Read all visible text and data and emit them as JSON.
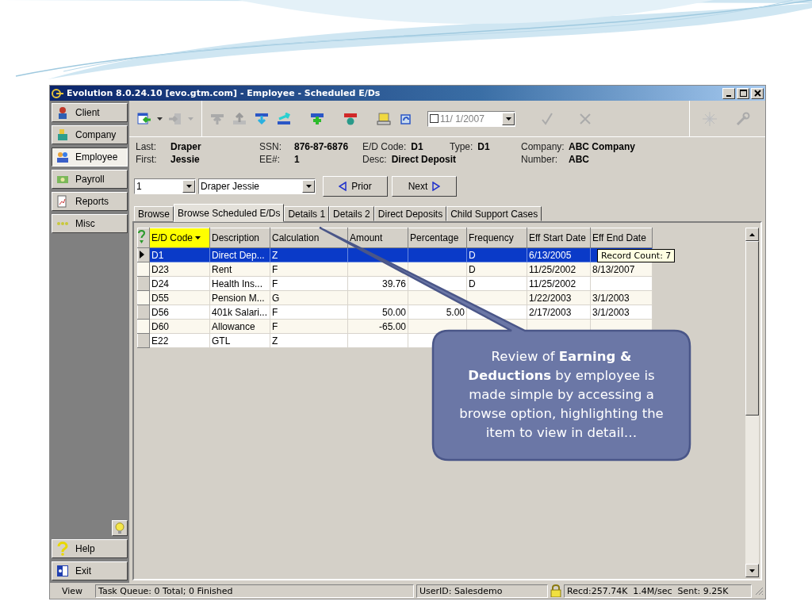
{
  "window": {
    "title": "Evolution 8.0.24.10 [evo.gtm.com] - Employee - Scheduled E/Ds"
  },
  "sidebar": {
    "items": [
      {
        "label": "Client",
        "selected": false
      },
      {
        "label": "Company",
        "selected": false
      },
      {
        "label": "Employee",
        "selected": true
      },
      {
        "label": "Payroll",
        "selected": false
      },
      {
        "label": "Reports",
        "selected": false
      },
      {
        "label": "Misc",
        "selected": false
      }
    ],
    "bottom_items": [
      {
        "label": "Help"
      },
      {
        "label": "Exit"
      }
    ]
  },
  "toolbar": {
    "date": "11/ 1/2007",
    "date_checked": false
  },
  "employee": {
    "groups": [
      {
        "lines": [
          {
            "label": "Last:",
            "value": "Draper"
          },
          {
            "label": "First:",
            "value": "Jessie"
          }
        ]
      },
      {
        "lines": [
          {
            "label": "SSN:",
            "value": "876-87-6876"
          },
          {
            "label": "EE#:",
            "value": "1"
          }
        ]
      },
      {
        "lines": [
          {
            "label": "E/D Code:",
            "value": "D1"
          },
          {
            "label": "Desc:",
            "value": "Direct Deposit"
          }
        ]
      },
      {
        "lines": [
          {
            "label": "Type:",
            "value": "D1"
          }
        ]
      },
      {
        "lines": [
          {
            "label": "Company:",
            "value": "ABC Company"
          },
          {
            "label": "Number:",
            "value": "ABC"
          }
        ]
      }
    ]
  },
  "selector": {
    "number": "1",
    "name": "Draper Jessie",
    "prior": "Prior",
    "next": "Next"
  },
  "tabs": [
    {
      "label": "Browse",
      "selected": false
    },
    {
      "label": "Browse Scheduled E/Ds",
      "selected": true
    },
    {
      "label": "Details 1",
      "selected": false
    },
    {
      "label": "Details 2",
      "selected": false
    },
    {
      "label": "Direct Deposits",
      "selected": false
    },
    {
      "label": "Child Support Cases",
      "selected": false
    }
  ],
  "table": {
    "columns": [
      {
        "label": "E/D Code",
        "kind": "text",
        "sorted": true
      },
      {
        "label": "Description",
        "kind": "text",
        "sorted": false
      },
      {
        "label": "Calculation",
        "kind": "text",
        "sorted": false
      },
      {
        "label": "Amount",
        "kind": "number",
        "sorted": false
      },
      {
        "label": "Percentage",
        "kind": "number",
        "sorted": false
      },
      {
        "label": "Frequency",
        "kind": "text",
        "sorted": false
      },
      {
        "label": "Eff Start Date",
        "kind": "text",
        "sorted": false
      },
      {
        "label": "Eff End Date",
        "kind": "text",
        "sorted": false
      }
    ],
    "rows": [
      {
        "selected": true,
        "cells": [
          "D1",
          "Direct Dep...",
          "Z",
          "",
          "",
          "D",
          "6/13/2005",
          ""
        ]
      },
      {
        "selected": false,
        "cells": [
          "D23",
          "Rent",
          "F",
          "",
          "",
          "D",
          "11/25/2002",
          "8/13/2007"
        ]
      },
      {
        "selected": false,
        "cells": [
          "D24",
          "Health Ins...",
          "F",
          "39.76",
          "",
          "D",
          "11/25/2002",
          ""
        ]
      },
      {
        "selected": false,
        "cells": [
          "D55",
          "Pension M...",
          "G",
          "",
          "",
          "",
          "1/22/2003",
          "3/1/2003"
        ]
      },
      {
        "selected": false,
        "cells": [
          "D56",
          "401k Salari...",
          "F",
          "50.00",
          "5.00",
          "",
          "2/17/2003",
          "3/1/2003"
        ]
      },
      {
        "selected": false,
        "cells": [
          "D60",
          "Allowance",
          "F",
          "-65.00",
          "",
          "",
          "",
          ""
        ]
      },
      {
        "selected": false,
        "cells": [
          "E22",
          "GTL",
          "Z",
          "",
          "",
          "",
          "",
          ""
        ]
      }
    ],
    "tooltip": "Record Count: 7"
  },
  "status_bar": {
    "view": "View",
    "task": "Task Queue: 0 Total; 0 Finished",
    "user": "UserID: Salesdemo",
    "traffic": "Recd:257.74K  1.4M/sec  Sent: 9.25K"
  },
  "callout": {
    "text": "Review of **Earning & Deductions** by employee is made simple by accessing a browse option, highlighting the item to view in detail…"
  }
}
